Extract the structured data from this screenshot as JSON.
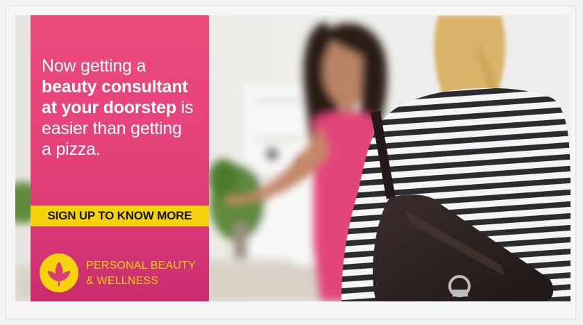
{
  "ad": {
    "headline": {
      "line1": "Now getting a",
      "line2": "beauty consultant",
      "line3": "at your doorstep",
      "line3_suffix": " is",
      "line4": "easier than getting",
      "line5": "a pizza."
    },
    "cta_label": "SIGN UP TO KNOW MORE",
    "brand": {
      "line1": "PERSONAL BEAUTY",
      "line2": "& WELLNESS"
    },
    "colors": {
      "panel": "#e8467a",
      "cta": "#f5d20c",
      "brand_text": "#f5d20c"
    },
    "icons": [
      "lotus-logo-icon"
    ]
  }
}
